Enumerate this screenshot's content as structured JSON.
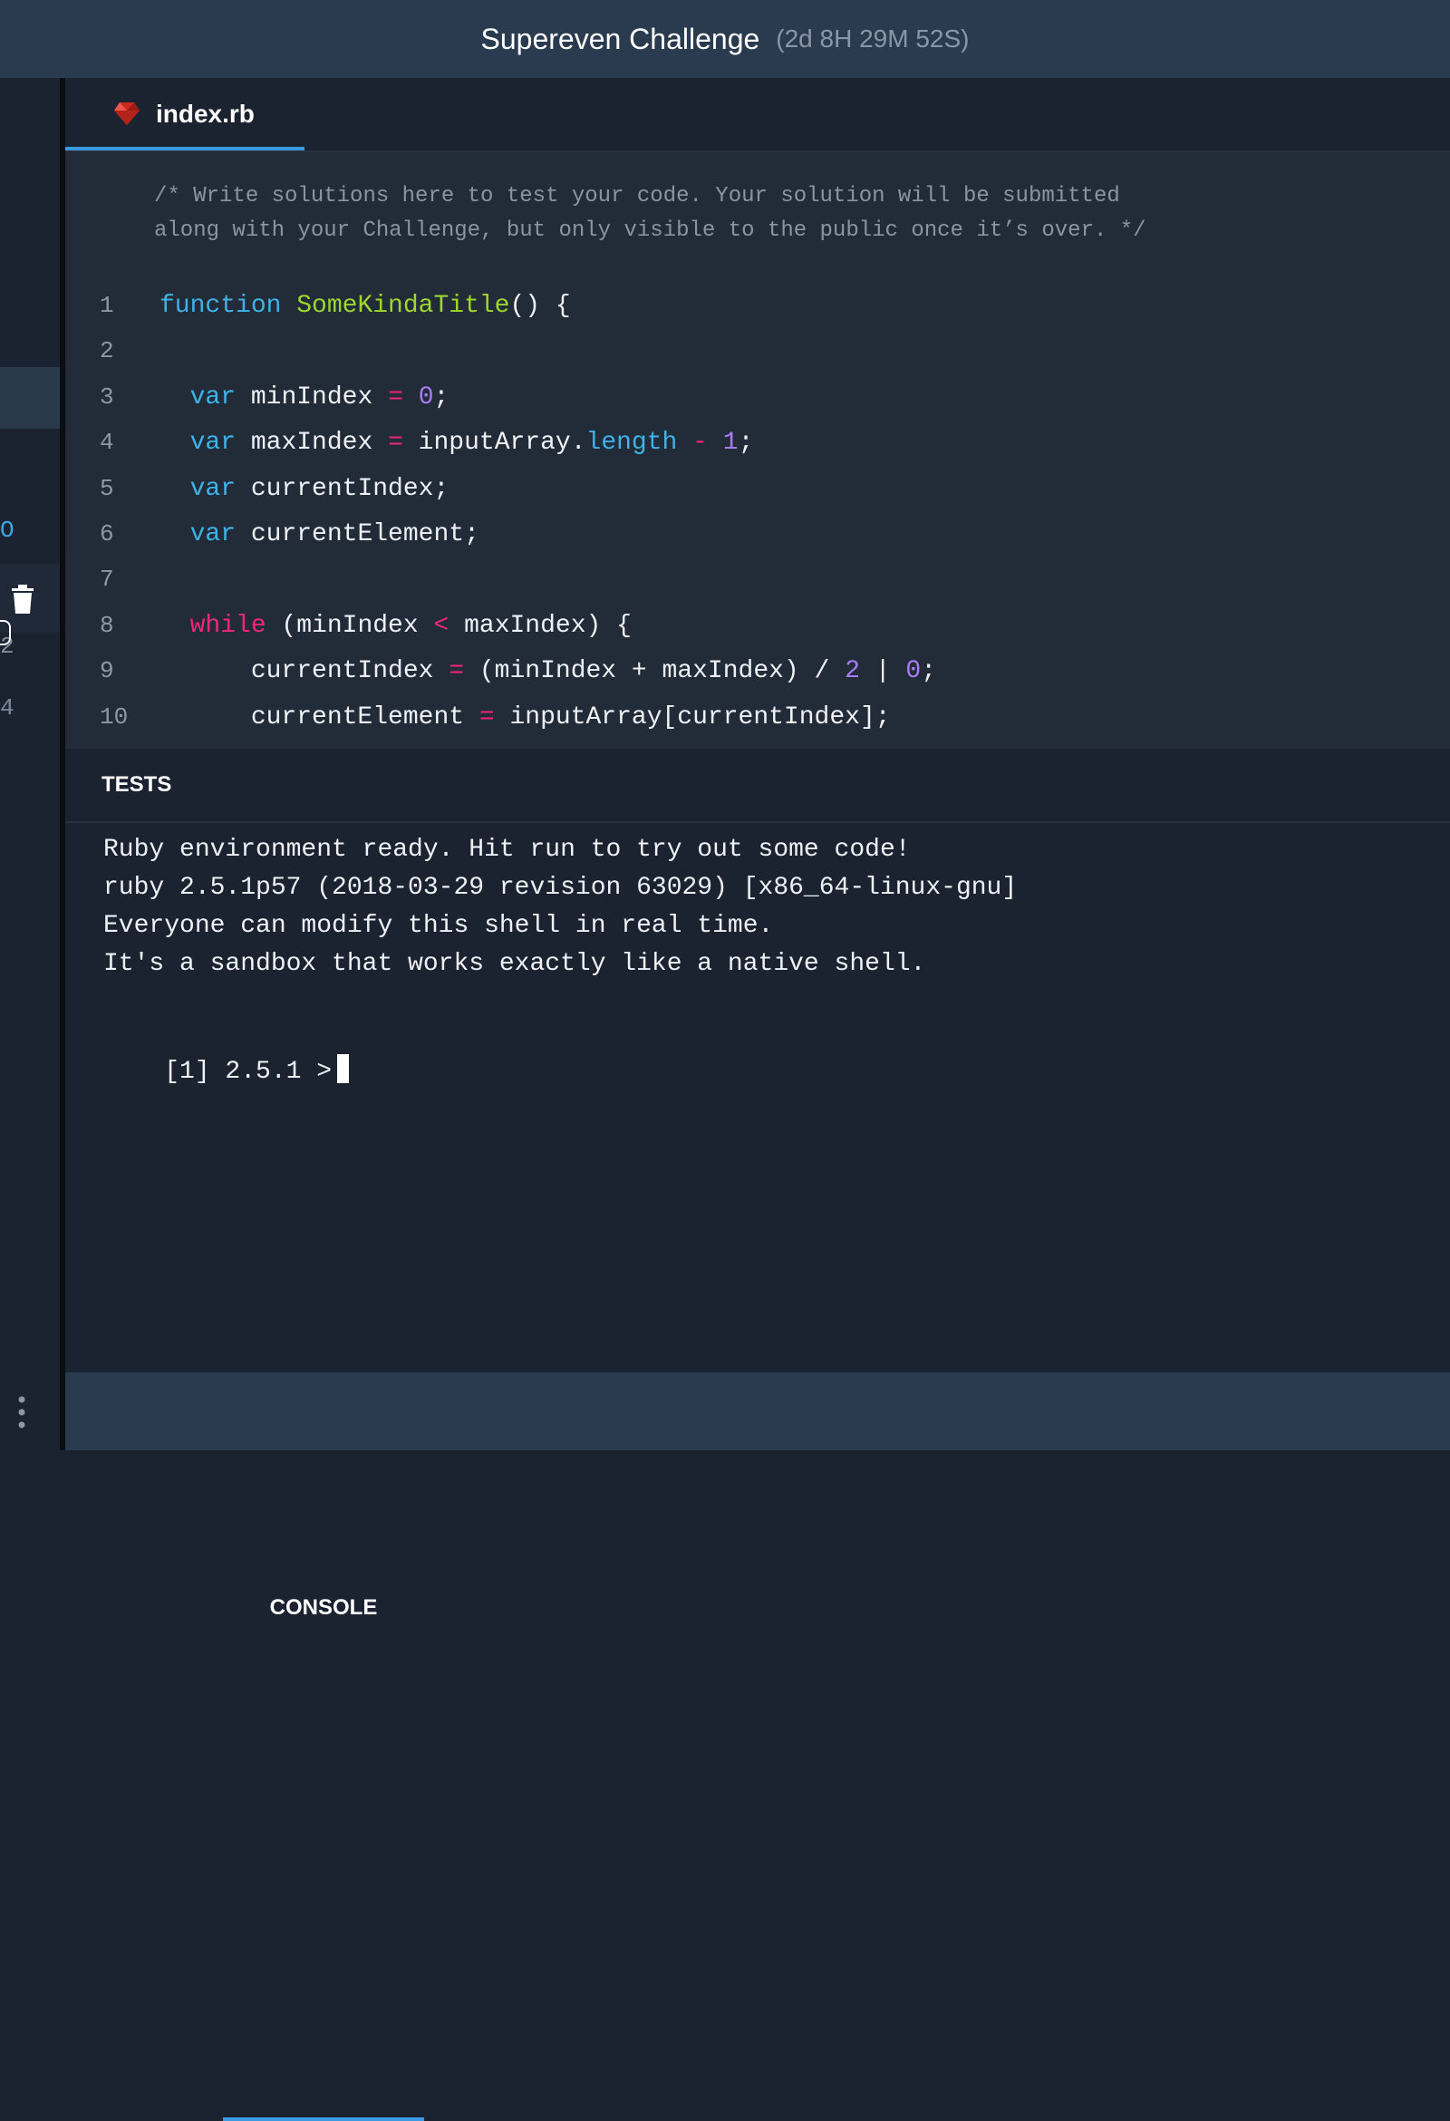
{
  "header": {
    "title": "Supereven Challenge",
    "countdown": "(2d 8H 29M 52S)"
  },
  "sidebar": {
    "fragments": [
      "O",
      "2",
      "4"
    ]
  },
  "editor": {
    "tab": {
      "filename": "index.rb"
    },
    "comment": "/* Write solutions here to test your code. Your solution will be submitted\nalong with your Challenge, but only visible to the public once it’s over. */",
    "lines": [
      {
        "n": "1",
        "tokens": [
          {
            "t": "function",
            "c": "kw"
          },
          {
            "t": " "
          },
          {
            "t": "SomeKindaTitle",
            "c": "fn"
          },
          {
            "t": "() {"
          }
        ]
      },
      {
        "n": "2",
        "tokens": []
      },
      {
        "n": "3",
        "tokens": [
          {
            "t": "  "
          },
          {
            "t": "var",
            "c": "kw"
          },
          {
            "t": " minIndex "
          },
          {
            "t": "=",
            "c": "op"
          },
          {
            "t": " "
          },
          {
            "t": "0",
            "c": "num"
          },
          {
            "t": ";"
          }
        ]
      },
      {
        "n": "4",
        "tokens": [
          {
            "t": "  "
          },
          {
            "t": "var",
            "c": "kw"
          },
          {
            "t": " maxIndex "
          },
          {
            "t": "=",
            "c": "op"
          },
          {
            "t": " inputArray."
          },
          {
            "t": "length",
            "c": "kw"
          },
          {
            "t": " "
          },
          {
            "t": "-",
            "c": "op"
          },
          {
            "t": " "
          },
          {
            "t": "1",
            "c": "num"
          },
          {
            "t": ";"
          }
        ]
      },
      {
        "n": "5",
        "tokens": [
          {
            "t": "  "
          },
          {
            "t": "var",
            "c": "kw"
          },
          {
            "t": " currentIndex;"
          }
        ]
      },
      {
        "n": "6",
        "tokens": [
          {
            "t": "  "
          },
          {
            "t": "var",
            "c": "kw"
          },
          {
            "t": " currentElement;"
          }
        ]
      },
      {
        "n": "7",
        "tokens": []
      },
      {
        "n": "8",
        "tokens": [
          {
            "t": "  "
          },
          {
            "t": "while",
            "c": "ctl"
          },
          {
            "t": " (minIndex "
          },
          {
            "t": "<",
            "c": "op"
          },
          {
            "t": " maxIndex) {"
          }
        ]
      },
      {
        "n": "9",
        "tokens": [
          {
            "t": "      currentIndex "
          },
          {
            "t": "=",
            "c": "op"
          },
          {
            "t": " (minIndex + maxIndex) / "
          },
          {
            "t": "2",
            "c": "num"
          },
          {
            "t": " | "
          },
          {
            "t": "0",
            "c": "num"
          },
          {
            "t": ";"
          }
        ]
      },
      {
        "n": "10",
        "tokens": [
          {
            "t": "      currentElement "
          },
          {
            "t": "=",
            "c": "op"
          },
          {
            "t": " inputArray[currentIndex];"
          }
        ]
      }
    ]
  },
  "panel": {
    "tabs": {
      "tests": "TESTS",
      "console": "CONSOLE"
    }
  },
  "console": {
    "lines": [
      "Ruby environment ready. Hit run to try out some code!",
      "ruby 2.5.1p57 (2018-03-29 revision 63029) [x86_64-linux-gnu]",
      "Everyone can modify this shell in real time.",
      "It's a sandbox that works exactly like a native shell."
    ],
    "prompt": "[1] 2.5.1 >"
  },
  "icons": {
    "file": "ruby-icon",
    "delete": "trash-icon",
    "menu": "more-vertical-icon"
  },
  "colors": {
    "header_bg": "#2a3a4f",
    "editor_bg": "#222b38",
    "console_bg": "#1b2230",
    "accent": "#3b9ae1",
    "keyword": "#3fb3e8",
    "function": "#9fd62e",
    "control": "#f0267a",
    "number": "#a77cf2"
  }
}
